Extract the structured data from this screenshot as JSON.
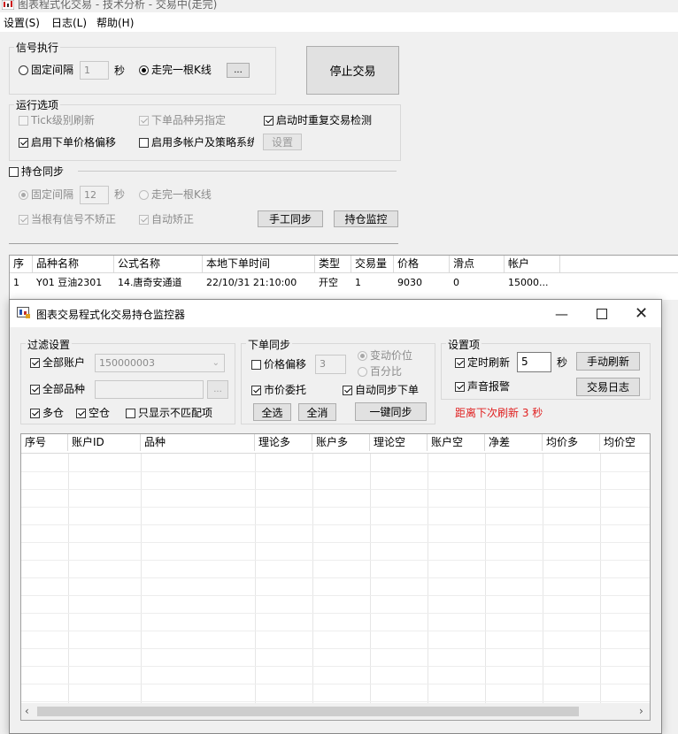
{
  "window": {
    "title": "图表程式化交易 - 技术分析 - 交易中(走完)"
  },
  "menu": [
    {
      "label": "设置(S)"
    },
    {
      "label": "日志(L)"
    },
    {
      "label": "帮助(H)"
    }
  ],
  "signal": {
    "legend": "信号执行",
    "fixed_interval_label": "固定间隔",
    "fixed_interval_value": "1",
    "seconds_label": "秒",
    "finish_bar_label": "走完一根K线",
    "ellipsis_label": "...",
    "stop_button": "停止交易"
  },
  "run_options": {
    "legend": "运行选项",
    "tick_refresh": "Tick级别刷新",
    "order_symbol": "下单品种另指定",
    "startup_check": "启动时重复交易检测",
    "price_offset": "启用下单价格偏移",
    "multi_account": "启用多帐户及策略系统",
    "settings_button": "设置"
  },
  "position_sync": {
    "title": "持仓同步",
    "fixed_interval_label": "固定间隔",
    "fixed_interval_value": "12",
    "seconds_label": "秒",
    "finish_bar_label": "走完一根K线",
    "no_correct_label": "当根有信号不矫正",
    "auto_correct_label": "自动矫正",
    "manual_sync_button": "手工同步",
    "monitor_button": "持仓监控"
  },
  "orders_table": {
    "headers": [
      "序",
      "品种名称",
      "公式名称",
      "本地下单时间",
      "类型",
      "交易量",
      "价格",
      "滑点",
      "帐户"
    ],
    "rows": [
      [
        "1",
        "Y01 豆油2301",
        "14.唐奇安通道",
        "22/10/31 21:10:00",
        "开空",
        "1",
        "9030",
        "0",
        "15000..."
      ]
    ]
  },
  "dialog": {
    "title": "图表交易程式化交易持仓监控器",
    "filter": {
      "legend": "过滤设置",
      "all_accounts": "全部账户",
      "account_value": "150000003",
      "all_symbols": "全部品种",
      "browse_label": "...",
      "long_label": "多仓",
      "short_label": "空仓",
      "mismatch_only": "只显示不匹配项"
    },
    "order_sync": {
      "legend": "下单同步",
      "price_offset": "价格偏移",
      "offset_value": "3",
      "tick_change": "变动价位",
      "percent": "百分比",
      "market_order": "市价委托",
      "auto_sync": "自动同步下单",
      "select_all": "全选",
      "deselect_all": "全消",
      "one_click_sync": "一键同步"
    },
    "settings": {
      "legend": "设置项",
      "timed_refresh": "定时刷新",
      "refresh_value": "5",
      "seconds_label": "秒",
      "manual_refresh": "手动刷新",
      "sound_alarm": "声音报警",
      "trade_log": "交易日志",
      "countdown": "距离下次刷新 3 秒"
    },
    "table_headers": [
      "序号",
      "账户ID",
      "品种",
      "理论多",
      "账户多",
      "理论空",
      "账户空",
      "净差",
      "均价多",
      "均价空"
    ]
  },
  "colors": {
    "accent_red": "#e02020",
    "window_bg": "#f0f0f0"
  }
}
